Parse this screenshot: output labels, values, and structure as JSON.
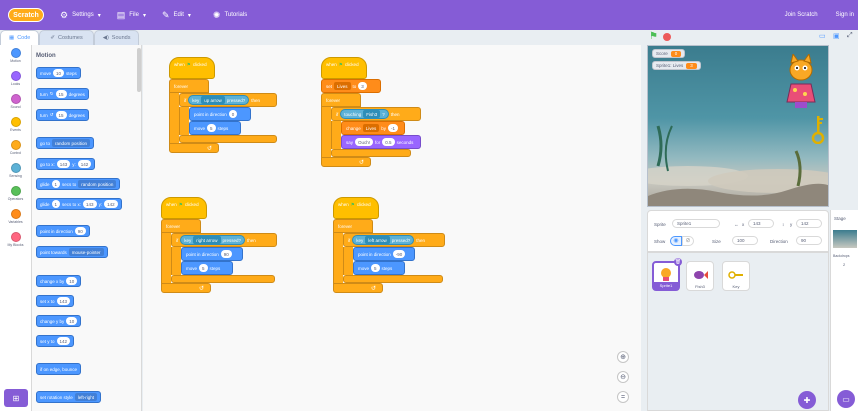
{
  "menu": {
    "logo": "Scratch",
    "settings": "Settings",
    "file": "File",
    "edit": "Edit",
    "tutorials": "Tutorials",
    "join": "Join Scratch",
    "signin": "Sign in"
  },
  "tabs": {
    "code": "Code",
    "costumes": "Costumes",
    "sounds": "Sounds"
  },
  "categories": [
    {
      "label": "Motion",
      "color": "#4c97ff"
    },
    {
      "label": "Looks",
      "color": "#9966ff"
    },
    {
      "label": "Sound",
      "color": "#cf63cf"
    },
    {
      "label": "Events",
      "color": "#ffbf00"
    },
    {
      "label": "Control",
      "color": "#ffab19"
    },
    {
      "label": "Sensing",
      "color": "#5cb1d6"
    },
    {
      "label": "Operators",
      "color": "#59c059"
    },
    {
      "label": "Variables",
      "color": "#ff8c1a"
    },
    {
      "label": "My Blocks",
      "color": "#ff6680"
    }
  ],
  "palette": {
    "title": "Motion",
    "move": {
      "a": "move",
      "n": "10",
      "b": "steps"
    },
    "turn_right": {
      "a": "turn",
      "n": "15",
      "b": "degrees"
    },
    "turn_left": {
      "a": "turn",
      "n": "15",
      "b": "degrees"
    },
    "goto": {
      "a": "go to",
      "dd": "random position"
    },
    "gotoxy": {
      "a": "go to x:",
      "x": "143",
      "b": "y:",
      "y": "142"
    },
    "glide_to": {
      "a": "glide",
      "n": "1",
      "b": "secs to",
      "dd": "random position"
    },
    "glide_xy": {
      "a": "glide",
      "n": "1",
      "b": "secs to x:",
      "x": "143",
      "c": "y:",
      "y": "142"
    },
    "point_dir": {
      "a": "point in direction",
      "n": "90"
    },
    "point_towards": {
      "a": "point towards",
      "dd": "mouse-pointer"
    },
    "change_x": {
      "a": "change x by",
      "n": "10"
    },
    "set_x": {
      "a": "set x to",
      "n": "143"
    },
    "change_y": {
      "a": "change y by",
      "n": "10"
    },
    "set_y": {
      "a": "set y to",
      "n": "142"
    },
    "bounce": "if on edge, bounce",
    "rotation": {
      "a": "set rotation style",
      "dd": "left-right"
    }
  },
  "scripts": {
    "s1": {
      "hat": "when",
      "hat2": "clicked",
      "loop": "forever",
      "if": "if",
      "key": "key",
      "keydd": "up arrow",
      "pressed": "pressed?",
      "then": "then",
      "point": "point in direction",
      "dir": "0",
      "move": "move",
      "steps_n": "5",
      "steps": "steps"
    },
    "s2": {
      "hat": "when",
      "hat2": "clicked",
      "set": "set",
      "var": "Lives",
      "to": "to",
      "n": "3",
      "loop": "forever",
      "if": "if",
      "touching": "touching",
      "obj": "Fish3",
      "q": "?",
      "then": "then",
      "change": "change",
      "var2": "Lives",
      "by": "by",
      "n2": "-1",
      "say": "say",
      "msg": "Ouch!",
      "for": "for",
      "secs": "0.5",
      "seconds": "seconds"
    },
    "s3": {
      "hat": "when",
      "hat2": "clicked",
      "loop": "forever",
      "if": "if",
      "key": "key",
      "keydd": "right arrow",
      "pressed": "pressed?",
      "then": "then",
      "point": "point in direction",
      "dir": "90",
      "move": "move",
      "steps_n": "5",
      "steps": "steps"
    },
    "s4": {
      "hat": "when",
      "hat2": "clicked",
      "loop": "forever",
      "if": "if",
      "key": "key",
      "keydd": "left arrow",
      "pressed": "pressed?",
      "then": "then",
      "point": "point in direction",
      "dir": "-90",
      "move": "move",
      "steps_n": "5",
      "steps": "steps"
    }
  },
  "stage": {
    "monitors": [
      {
        "label": "Score",
        "value": "0"
      },
      {
        "label": "Sprite1: Lives",
        "value": "3"
      }
    ]
  },
  "sprite_info": {
    "sprite_lbl": "Sprite",
    "sprite_name": "Sprite1",
    "x_lbl": "x",
    "x": "143",
    "y_lbl": "y",
    "y": "142",
    "show_lbl": "Show",
    "size_lbl": "Size",
    "size": "100",
    "dir_lbl": "Direction",
    "dir": "90"
  },
  "sprites": [
    {
      "name": "Sprite1"
    },
    {
      "name": "Fish3"
    },
    {
      "name": "Key"
    }
  ],
  "stage_pane": {
    "title": "Stage",
    "backdrops_lbl": "Backdrops",
    "backdrops_n": "2"
  }
}
